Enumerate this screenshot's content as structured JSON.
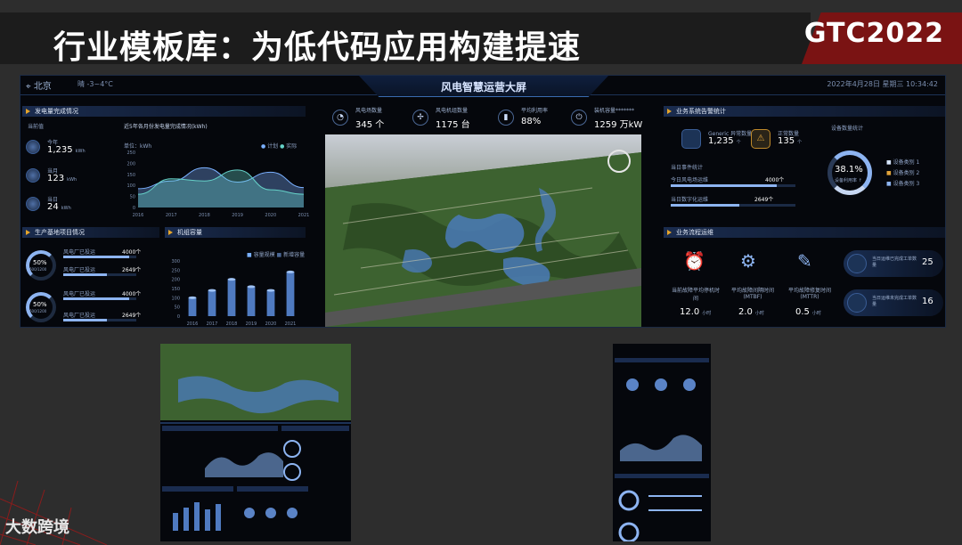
{
  "slide": {
    "title": "行业模板库：为低代码应用构建提速",
    "brand": "GTC2022",
    "footer_logo": "大数跨境"
  },
  "dashboard": {
    "title": "风电智慧运营大屏",
    "city": "北京",
    "weather": "晴  -3~4°C",
    "datetime": "2022年4月28日 星期三  10:34:42",
    "power_panel": {
      "title": "发电量完成情况",
      "unit_label": "当前值",
      "items": [
        {
          "label": "今年",
          "value": "1,235",
          "unit": "kWh"
        },
        {
          "label": "当月",
          "value": "123",
          "unit": "kWh"
        },
        {
          "label": "当日",
          "value": "24",
          "unit": "kWh"
        }
      ],
      "chart_title": "近5年各月份发电量完成情况(kWh)",
      "legend": [
        "计划",
        "实际"
      ],
      "chart_ylabel": "单位：kWh"
    },
    "project_panel": {
      "title": "生产基地项目情况",
      "rings": [
        {
          "pct": "50%",
          "sub": "600/1200"
        },
        {
          "pct": "50%",
          "sub": "600/1200"
        }
      ],
      "rows": [
        {
          "label": "风电厂已投运",
          "value": "4000个",
          "fill": 0.9
        },
        {
          "label": "风电厂已投运",
          "value": "2649个",
          "fill": 0.6
        },
        {
          "label": "风电厂已投运",
          "value": "4000个",
          "fill": 0.9
        },
        {
          "label": "风电厂已投运",
          "value": "2649个",
          "fill": 0.6
        }
      ]
    },
    "unit_panel": {
      "title": "机组容量",
      "legend": [
        "容量规模",
        "新增容量"
      ]
    },
    "kpis": [
      {
        "label": "风电场数量",
        "value": "345 个",
        "icon": "gauge-icon"
      },
      {
        "label": "风电机组数量",
        "value": "1175 台",
        "icon": "turbine-icon"
      },
      {
        "label": "平均利用率",
        "value": "88%",
        "icon": "chart-icon"
      },
      {
        "label": "装机容量*******",
        "value": "1259 万kW",
        "icon": "power-icon"
      }
    ],
    "equipment_panel": {
      "title": "业务系统告警统计",
      "alarm_label": "Generic 异常数量",
      "alarm_value": "1,235",
      "alarm_unit": "个",
      "warn_label": "正常数量",
      "warn_value": "135",
      "warn_unit": "个",
      "ring_pct": "38.1%",
      "ring_sub": "设备利用率 ↑",
      "ring_title": "设备数量统计",
      "legend": [
        "设备类别 1",
        "设备类别 2",
        "设备类别 3"
      ],
      "subsection": "当日事件统计",
      "rows": [
        {
          "label": "今日风电场运维",
          "value": "4000个",
          "fill": 0.85
        },
        {
          "label": "当日数字化运维",
          "value": "2649个",
          "fill": 0.55
        }
      ]
    },
    "ops_panel": {
      "title": "业务流程运维",
      "items": [
        {
          "label": "当前故障平均停机时间",
          "value": "12.0",
          "unit": "小时",
          "icon": "alarm-clock-icon"
        },
        {
          "label": "平均故障间隔时间(MTBF)",
          "value": "2.0",
          "unit": "小时",
          "icon": "gear-icon"
        },
        {
          "label": "平均故障修复时间(MTTR)",
          "value": "0.5",
          "unit": "小时",
          "icon": "wrench-icon"
        }
      ],
      "side": [
        {
          "label": "当日运维已完成工单数量",
          "value": "25"
        },
        {
          "label": "当日运维未完成工单数量",
          "value": "16"
        }
      ]
    }
  },
  "chart_area": {
    "type": "area",
    "x": [
      "2016",
      "2017",
      "2018",
      "2019",
      "2020",
      "2021"
    ],
    "yticks": [
      "0",
      "50",
      "100",
      "150",
      "200",
      "250"
    ],
    "ylim": [
      0,
      250
    ],
    "series": [
      {
        "name": "计划",
        "values": [
          85,
          120,
          180,
          115,
          160,
          90
        ]
      },
      {
        "name": "实际",
        "values": [
          60,
          130,
          120,
          170,
          80,
          60
        ]
      }
    ]
  },
  "chart_bar": {
    "type": "bar",
    "categories": [
      "2016",
      "2017",
      "2018",
      "2019",
      "2020",
      "2021"
    ],
    "ylim": [
      0,
      300
    ],
    "yticks": [
      "0",
      "50",
      "100",
      "150",
      "200",
      "250",
      "300"
    ],
    "series": [
      {
        "name": "容量规模",
        "values": [
          100,
          140,
          200,
          160,
          140,
          240
        ]
      }
    ]
  }
}
